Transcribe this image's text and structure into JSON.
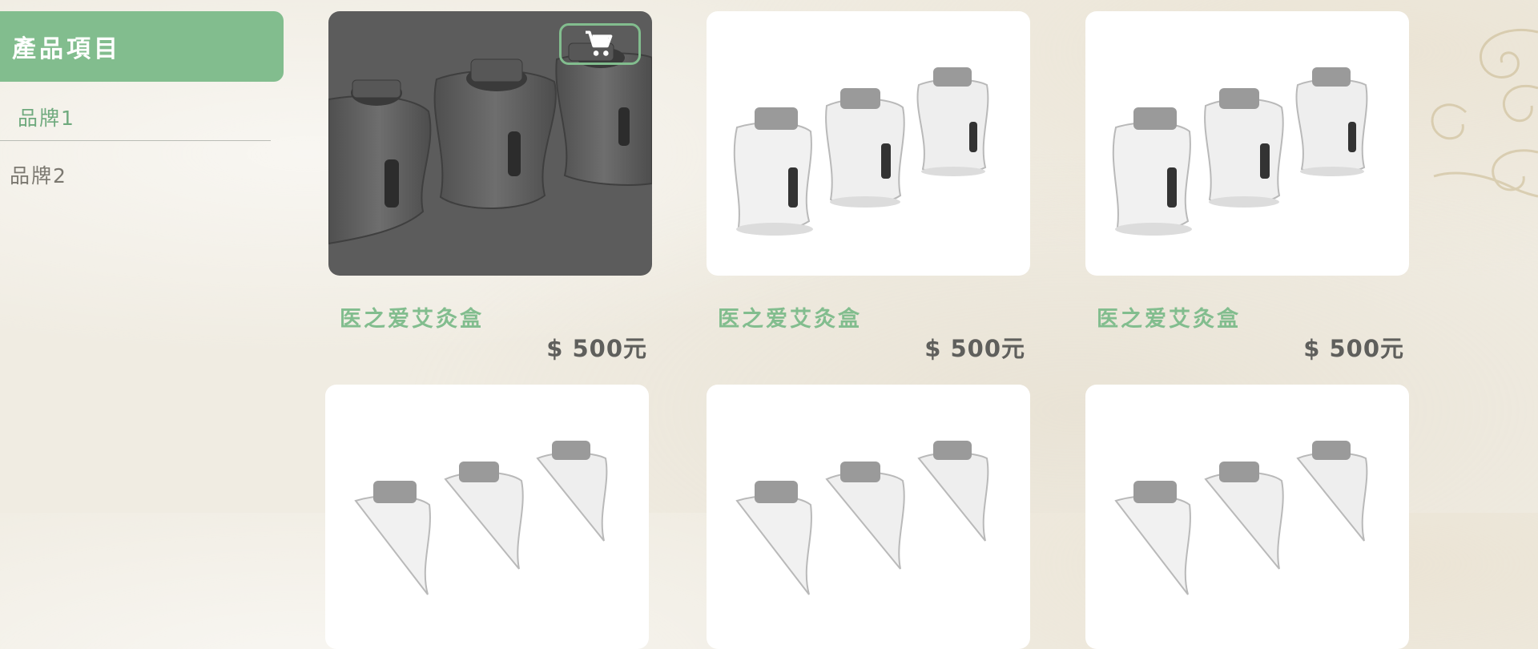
{
  "sidebar": {
    "title": "產品項目",
    "brands": [
      "品牌1",
      "品牌2"
    ]
  },
  "products": [
    {
      "name": "医之爱艾灸盒",
      "price": "$ 500元"
    },
    {
      "name": "医之爱艾灸盒",
      "price": "$ 500元"
    },
    {
      "name": "医之爱艾灸盒",
      "price": "$ 500元"
    }
  ],
  "colors": {
    "accent": "#82bd8e",
    "accent_text": "#6faa7e",
    "price_text": "#5f5f5c",
    "background": "#f0ece2",
    "hover_overlay": "#5c5c5c"
  },
  "icons": {
    "cart": "shopping-cart-icon"
  }
}
